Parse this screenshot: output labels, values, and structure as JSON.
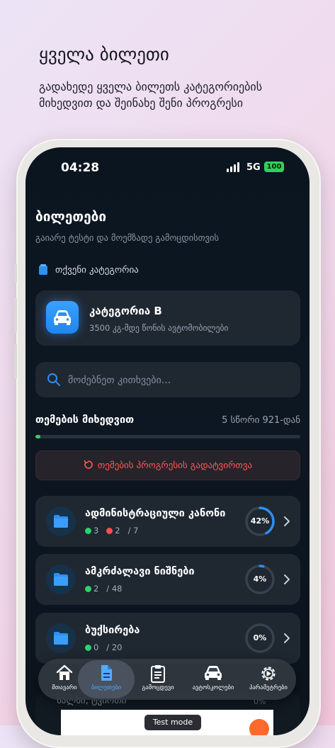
{
  "hero": {
    "title": "ყველა ბილეთი",
    "subtitle": "გადახედე ყველა ბილეთს კატეგორიების მიხედვით და შეინახე შენი პროგრესი"
  },
  "status_bar": {
    "time": "04:28",
    "network": "5G",
    "battery": "100"
  },
  "screen": {
    "title": "ბილეთები",
    "subtitle": "გაიარე ტესტი და მოემზადე გამოცდისთვის",
    "category_label": "თქვენი კატეგორია",
    "category": {
      "name": "კატეგორია B",
      "description": "3500 კგ-მდე წონის ავტომობილები"
    },
    "search": {
      "placeholder": "მოძებნეთ კითხვები..."
    },
    "section": {
      "title": "თემების მიხედვით",
      "count": "5 სწორი 921-დან",
      "progress": 0.02
    },
    "reset_label": "თემების პროგრესის გადატვირთვა",
    "topics": [
      {
        "name": "ადმინისტრაციული კანონი",
        "correct": "3",
        "wrong": "2",
        "total": "/ 7",
        "percent_label": "42%",
        "percent": 42
      },
      {
        "name": "ამკრძალავი ნიშნები",
        "correct": "2",
        "total": "/ 48",
        "percent_label": "4%",
        "percent": 4
      },
      {
        "name": "ბუქსირება",
        "correct": "0",
        "total": "/ 20",
        "percent_label": "0%",
        "percent": 0
      }
    ],
    "hidden_topic": {
      "name": "ხალხი, ტვირთი",
      "percent_label": "0%"
    }
  },
  "nav": {
    "items": [
      {
        "label": "მთავარი",
        "icon": "home-icon"
      },
      {
        "label": "ბილეთები",
        "icon": "document-icon",
        "active": true
      },
      {
        "label": "გამოცდევი",
        "icon": "clipboard-icon"
      },
      {
        "label": "ავტოსკოლები",
        "icon": "car-icon"
      },
      {
        "label": "პარამეტრები",
        "icon": "gear-icon"
      }
    ]
  },
  "ad": {
    "label": "Test mode"
  },
  "colors": {
    "accent": "#2d8ff0",
    "success": "#29d46a",
    "danger": "#ff4d4d",
    "card": "#1f2731",
    "screen_bg": "#0c141d"
  }
}
